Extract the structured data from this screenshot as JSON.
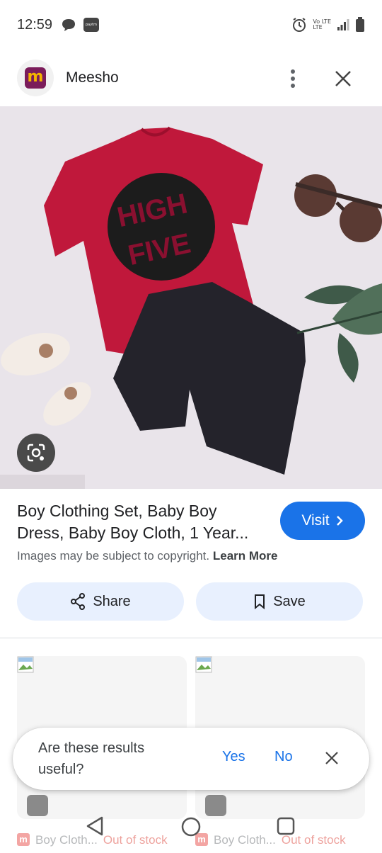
{
  "status_bar": {
    "time": "12:59",
    "paytm_label": "paytm",
    "network_top": "Vo LTE",
    "network_bottom": "LTE"
  },
  "header": {
    "site_name": "Meesho",
    "logo_letter": "m"
  },
  "result": {
    "title": "Boy Clothing Set, Baby Boy Dress, Baby Boy Cloth, 1 Year...",
    "visit_label": "Visit",
    "copyright_text": "Images may be subject to copyright.",
    "learn_more": "Learn More"
  },
  "actions": {
    "share_label": "Share",
    "save_label": "Save"
  },
  "image_text": {
    "shirt_line1": "HIGH",
    "shirt_line2": "FIVE"
  },
  "related": [
    {
      "name": "Boy Cloth...",
      "stock": "Out of stock"
    },
    {
      "name": "Boy Cloth...",
      "stock": "Out of stock"
    }
  ],
  "feedback": {
    "question": "Are these results useful?",
    "yes": "Yes",
    "no": "No"
  },
  "colors": {
    "accent": "#1a73e8",
    "pill_bg": "#e8f0fe",
    "brand": "#7b1c5a"
  }
}
